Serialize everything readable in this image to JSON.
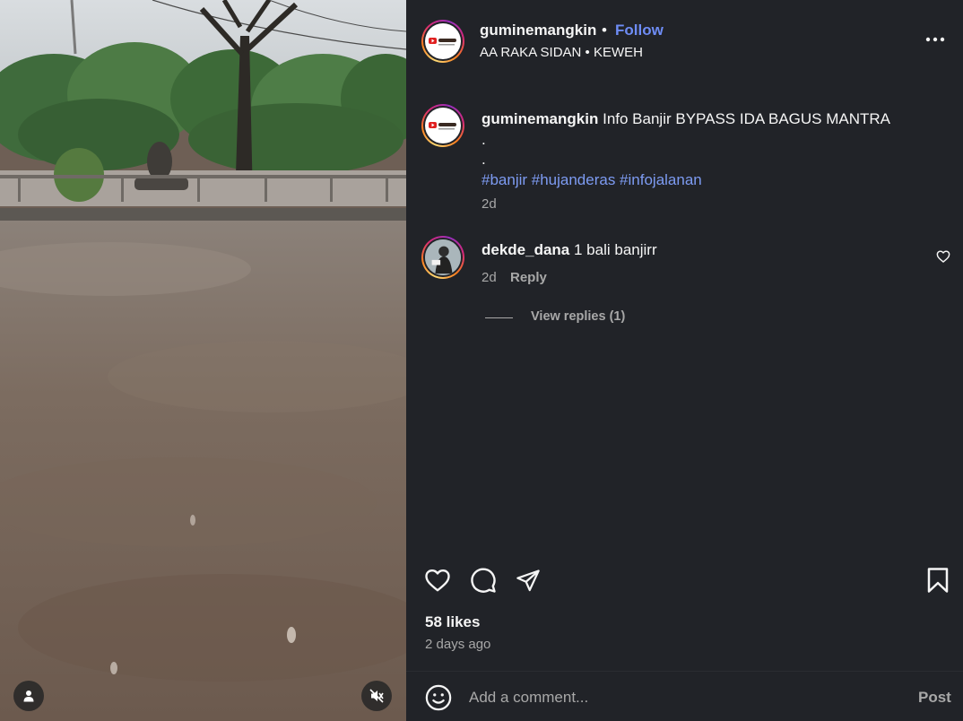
{
  "post": {
    "username": "guminemangkin",
    "dot": "•",
    "follow_label": "Follow",
    "subtitle": "AA RAKA SIDAN • KEWEH",
    "caption_user": "guminemangkin",
    "caption_text": "Info Banjir BYPASS IDA BAGUS MANTRA",
    "caption_line2": ".",
    "caption_line3": ".",
    "hashtags": "#banjir #hujanderas #infojalanan",
    "caption_time": "2d"
  },
  "comments": [
    {
      "user": "dekde_dana",
      "text": "1 bali banjirr",
      "time": "2d",
      "reply_label": "Reply",
      "view_replies": "View replies (1)"
    }
  ],
  "stats": {
    "likes": "58 likes",
    "posted_ago": "2 days ago"
  },
  "comment_box": {
    "placeholder": "Add a comment...",
    "post_label": "Post"
  },
  "icons": {
    "more": "more-options-icon",
    "like": "heart-icon",
    "comment": "comment-icon",
    "share": "share-icon",
    "save": "bookmark-icon",
    "emoji": "emoji-icon",
    "tagged_users": "user-icon",
    "mute": "muted-icon"
  },
  "colors": {
    "panel_bg": "#212328",
    "link_blue": "#6e8cf5",
    "hashtag_blue": "#7d9bf2",
    "secondary_text": "#a8a8a8"
  }
}
